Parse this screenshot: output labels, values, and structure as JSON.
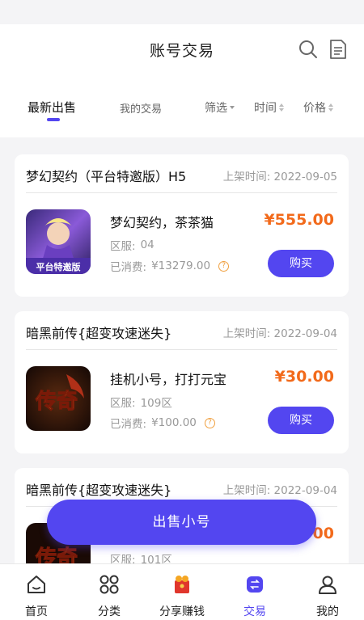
{
  "header": {
    "title": "账号交易"
  },
  "tabs": {
    "latest": "最新出售",
    "mine": "我的交易"
  },
  "filters": {
    "filter": "筛选",
    "time": "时间",
    "price": "价格"
  },
  "listings": [
    {
      "game_name": "梦幻契约（平台特邀版）H5",
      "listed": "上架时间: 2022-09-05",
      "item_title": "梦幻契约，茶茶猫",
      "server_label": "区服:",
      "server": "04",
      "spent_label": "已消费:",
      "spent": "¥13279.00",
      "price": "¥555.00",
      "buy": "购买",
      "thumb_text": "平台特邀版"
    },
    {
      "game_name": "暗黑前传{超变攻速迷失}",
      "listed": "上架时间: 2022-09-04",
      "item_title": "挂机小号，打打元宝",
      "server_label": "区服:",
      "server": "109区",
      "spent_label": "已消费:",
      "spent": "¥100.00",
      "price": "¥30.00",
      "buy": "购买",
      "thumb_text": "传奇"
    },
    {
      "game_name": "暗黑前传{超变攻速迷失}",
      "listed": "上架时间: 2022-09-04",
      "server_label": "区服:",
      "server": "101区",
      "price": "00",
      "thumb_text": "传奇"
    }
  ],
  "sell_button": "出售小号",
  "nav": {
    "home": "首页",
    "category": "分类",
    "share": "分享赚钱",
    "trade": "交易",
    "mine": "我的"
  },
  "colors": {
    "accent": "#5346f0",
    "price": "#f26a1b"
  }
}
